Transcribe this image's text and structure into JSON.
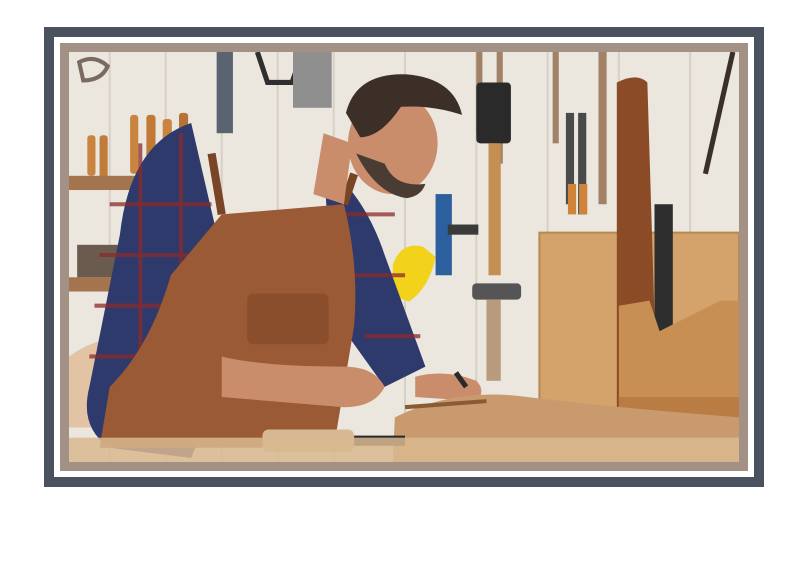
{
  "photo": {
    "subject": "carpenter-workshop",
    "palette": {
      "frame": "#4a5260",
      "mat": "#a39185",
      "wall": "#e9e4dc",
      "plaid_blue": "#2e3a6b",
      "plaid_red": "#8a2b2b",
      "apron": "#9a5a35",
      "wood": "#c89a6e",
      "skin": "#c98d6c",
      "hair": "#3b2f28",
      "yellow_tool": "#f2d21b",
      "blue_tool": "#2b5f9e"
    }
  }
}
